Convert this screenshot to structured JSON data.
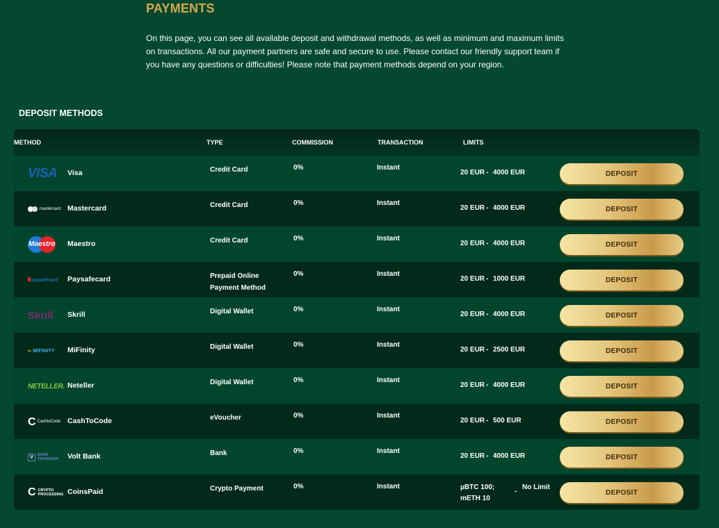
{
  "page": {
    "title": "PAYMENTS",
    "intro": "On this page, you can see all available deposit and withdrawal methods, as well as minimum and maximum limits on transactions. All our payment partners are safe and secure to use. Please contact our friendly support team if you have any questions or difficulties! Please note that payment methods depend on your region."
  },
  "deposit": {
    "section_title": "DEPOSIT METHODS",
    "columns": {
      "method": "METHOD",
      "type": "TYPE",
      "commission": "COMMISSION",
      "transaction": "TRANSACTION",
      "limits": "LIMITS"
    },
    "rows": [
      {
        "name": "Visa",
        "type": "Credit Card",
        "commission": "0%",
        "transaction": "Instant",
        "min": "20 EUR",
        "dash": "-",
        "max": "4000 EUR",
        "button": "DEPOSIT",
        "logo_text": "VISA"
      },
      {
        "name": "Mastercard",
        "type": "Credit Card",
        "commission": "0%",
        "transaction": "Instant",
        "min": "20 EUR",
        "dash": "-",
        "max": "4000 EUR",
        "button": "DEPOSIT",
        "logo_text": "mastercard"
      },
      {
        "name": "Maestro",
        "type": "Credit Card",
        "commission": "0%",
        "transaction": "Instant",
        "min": "20 EUR",
        "dash": "-",
        "max": "4000 EUR",
        "button": "DEPOSIT",
        "logo_text": "Maestro"
      },
      {
        "name": "Paysafecard",
        "type": "Prepaid Online Payment Method",
        "commission": "0%",
        "transaction": "Instant",
        "min": "20 EUR",
        "dash": "-",
        "max": "1000 EUR",
        "button": "DEPOSIT",
        "logo_text": "paysafecard"
      },
      {
        "name": "Skrill",
        "type": "Digital Wallet",
        "commission": "0%",
        "transaction": "Instant",
        "min": "20 EUR",
        "dash": "-",
        "max": "4000 EUR",
        "button": "DEPOSIT",
        "logo_text": "Skrill"
      },
      {
        "name": "MiFinity",
        "type": "Digital Wallet",
        "commission": "0%",
        "transaction": "Instant",
        "min": "20 EUR",
        "dash": "-",
        "max": "2500 EUR",
        "button": "DEPOSIT",
        "logo_text": "MIFINITY"
      },
      {
        "name": "Neteller",
        "type": "Digital Wallet",
        "commission": "0%",
        "transaction": "Instant",
        "min": "20 EUR",
        "dash": "-",
        "max": "4000 EUR",
        "button": "DEPOSIT",
        "logo_text": "NETELLER."
      },
      {
        "name": "CashToCode",
        "type": "eVoucher",
        "commission": "0%",
        "transaction": "Instant",
        "min": "20 EUR",
        "dash": "-",
        "max": "500 EUR",
        "button": "DEPOSIT",
        "logo_text": "CashtoCode"
      },
      {
        "name": "Volt Bank",
        "type": "Bank",
        "commission": "0%",
        "transaction": "Instant",
        "min": "20 EUR",
        "dash": "-",
        "max": "4000 EUR",
        "button": "DEPOSIT",
        "logo_text": "BANK TRANSFER"
      },
      {
        "name": "CoinsPaid",
        "type": "Crypto Payment",
        "commission": "0%",
        "transaction": "Instant",
        "min": "µBTC 100; mETH 10",
        "dash": "-",
        "max": "No Limit",
        "button": "DEPOSIT",
        "logo_text": "CRYPTO PROCESSING"
      }
    ]
  }
}
